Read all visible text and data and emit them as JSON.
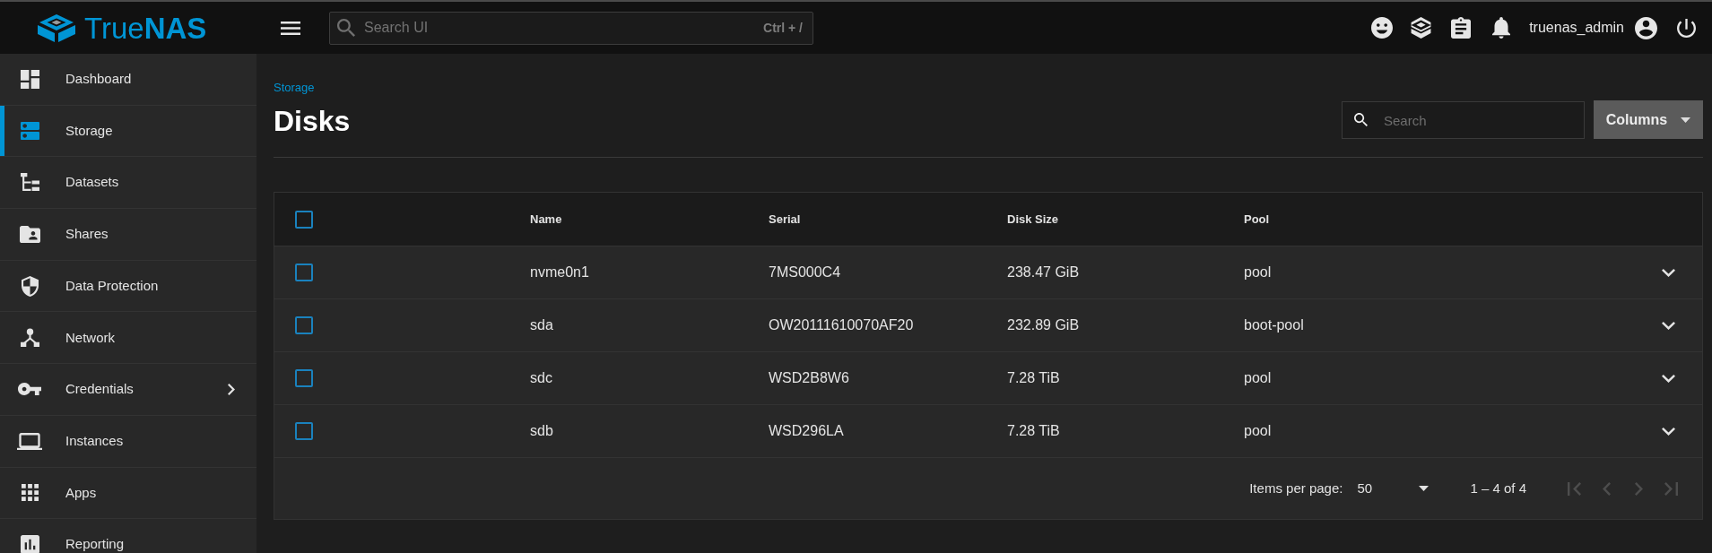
{
  "header": {
    "logo": "True**NAS**",
    "search": {
      "placeholder": "Search UI",
      "shortcut": "Ctrl + /"
    },
    "username": "truenas_admin"
  },
  "sidebar": {
    "items": [
      {
        "label": "Dashboard",
        "selected": false,
        "has_submenu": false
      },
      {
        "label": "Storage",
        "selected": true,
        "has_submenu": false
      },
      {
        "label": "Datasets",
        "selected": false,
        "has_submenu": false
      },
      {
        "label": "Shares",
        "selected": false,
        "has_submenu": false
      },
      {
        "label": "Data Protection",
        "selected": false,
        "has_submenu": false
      },
      {
        "label": "Network",
        "selected": false,
        "has_submenu": false
      },
      {
        "label": "Credentials",
        "selected": false,
        "has_submenu": true
      },
      {
        "label": "Instances",
        "selected": false,
        "has_submenu": false
      },
      {
        "label": "Apps",
        "selected": false,
        "has_submenu": false
      },
      {
        "label": "Reporting",
        "selected": false,
        "has_submenu": false
      }
    ]
  },
  "page": {
    "breadcrumb": "Storage",
    "title": "Disks",
    "search": {
      "placeholder": "Search"
    },
    "columns_button": "Columns"
  },
  "table": {
    "select_all": {
      "checked": false
    },
    "columns": [
      "Name",
      "Serial",
      "Disk Size",
      "Pool"
    ],
    "rows": [
      {
        "checked": false,
        "expanded": false,
        "cells": [
          "nvme0n1",
          "7MS000C4",
          "238.47 GiB",
          "pool"
        ]
      },
      {
        "checked": false,
        "expanded": false,
        "cells": [
          "sda",
          "OW20111610070AF20",
          "232.89 GiB",
          "boot-pool"
        ]
      },
      {
        "checked": false,
        "expanded": false,
        "cells": [
          "sdc",
          "WSD2B8W6",
          "7.28 TiB",
          "pool"
        ]
      },
      {
        "checked": false,
        "expanded": false,
        "cells": [
          "sdb",
          "WSD296LA",
          "7.28 TiB",
          "pool"
        ]
      }
    ]
  },
  "paginator": {
    "label": "Items per page:",
    "page_size": "50",
    "range": "1 – 4 of 4",
    "buttons": [
      {
        "kind": "first",
        "disabled": true
      },
      {
        "kind": "previous",
        "disabled": true
      },
      {
        "kind": "next",
        "disabled": true
      },
      {
        "kind": "last",
        "disabled": true
      }
    ]
  }
}
